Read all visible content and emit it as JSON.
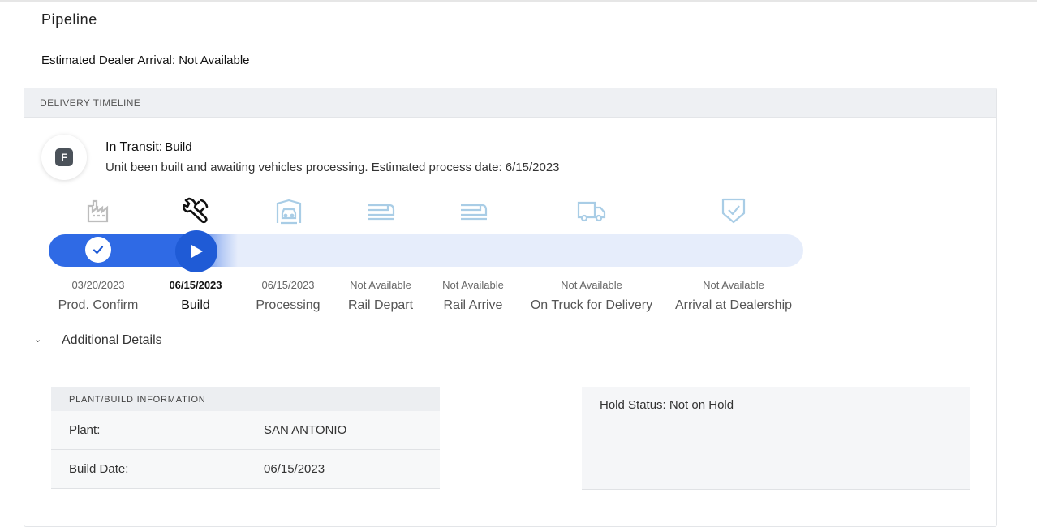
{
  "page": {
    "title": "Pipeline",
    "estimated_arrival": "Estimated Dealer Arrival: Not Available"
  },
  "timeline": {
    "header": "DELIVERY TIMELINE",
    "badge_letter": "F",
    "status_label": "In Transit:",
    "status_stage": "Build",
    "status_description": "Unit been built and awaiting vehicles processing. Estimated process date: 6/15/2023",
    "progress_fraction": 0.25,
    "steps": [
      {
        "name": "Prod. Confirm",
        "date": "03/20/2023",
        "state": "done",
        "icon": "factory-icon"
      },
      {
        "name": "Build",
        "date": "06/15/2023",
        "state": "current",
        "icon": "wrench-icon"
      },
      {
        "name": "Processing",
        "date": "06/15/2023",
        "state": "pending",
        "icon": "processing-icon"
      },
      {
        "name": "Rail Depart",
        "date": "Not Available",
        "state": "pending",
        "icon": "train-icon"
      },
      {
        "name": "Rail Arrive",
        "date": "Not Available",
        "state": "pending",
        "icon": "train-icon"
      },
      {
        "name": "On Truck for Delivery",
        "date": "Not Available",
        "state": "pending",
        "icon": "truck-icon"
      },
      {
        "name": "Arrival at Dealership",
        "date": "Not Available",
        "state": "pending",
        "icon": "shield-check-icon"
      }
    ]
  },
  "additional": {
    "toggle_label": "Additional Details",
    "plant_info": {
      "header": "PLANT/BUILD INFORMATION",
      "rows": [
        {
          "key": "Plant:",
          "value": "SAN ANTONIO"
        },
        {
          "key": "Build Date:",
          "value": "06/15/2023"
        }
      ]
    },
    "hold_status": "Hold Status: Not on Hold"
  },
  "colors": {
    "accent": "#1f5bd6",
    "track": "#e6edfb",
    "pending_icon": "#a9cde6",
    "done_icon": "#bdbdbd"
  }
}
